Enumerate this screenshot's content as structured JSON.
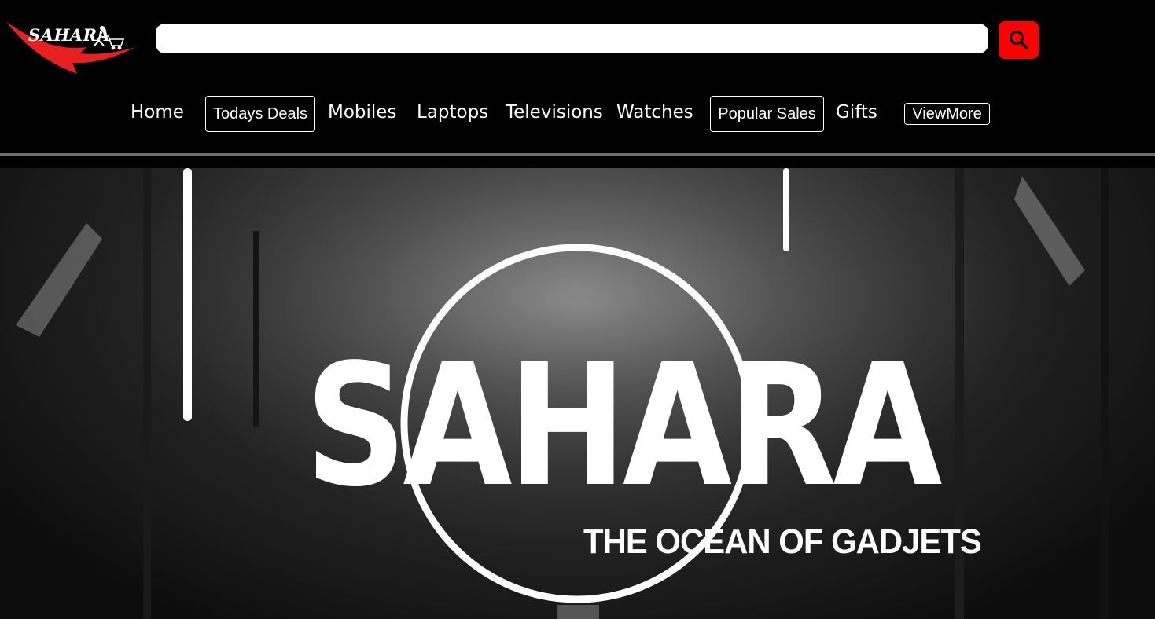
{
  "header": {
    "logo_text": "SAHARA",
    "search": {
      "value": "",
      "placeholder": ""
    },
    "search_icon": "search-icon"
  },
  "nav": {
    "home": "Home",
    "todays_deals": "Todays Deals",
    "mobiles": "Mobiles",
    "laptops": "Laptops",
    "televisions": "Televisions",
    "watches": "Watches",
    "popular_sales": "Popular Sales",
    "gifts": "Gifts",
    "view_more": "ViewMore"
  },
  "hero": {
    "title": "SAHARA",
    "tagline": "THE OCEAN OF GADJETS"
  },
  "colors": {
    "accent": "#ff0000",
    "background": "#000000",
    "text": "#ffffff"
  }
}
